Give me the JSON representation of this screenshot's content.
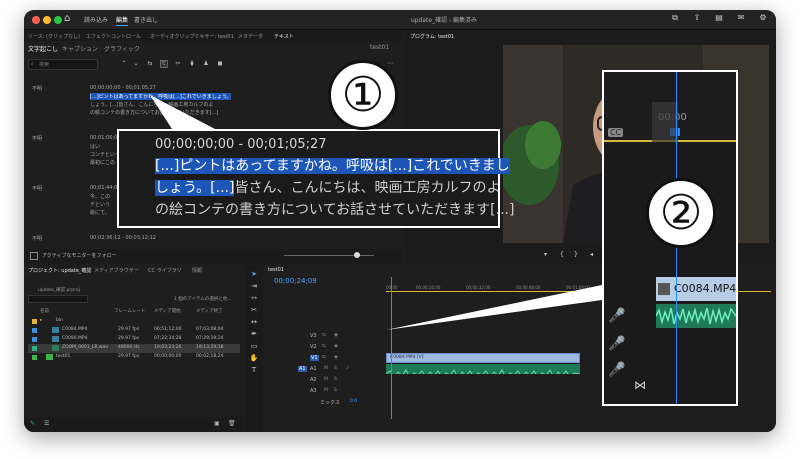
{
  "window": {
    "title": "update_確認 - 編集済み",
    "nav": [
      "読み込み",
      "編集",
      "書き出し"
    ],
    "active_nav": "編集"
  },
  "source_panel": {
    "tabs": [
      "ソース: (クリップなし)",
      "エフェクトコントロール",
      "オーディオクリップミキサー: test01",
      "メタデータ",
      "テキスト"
    ],
    "sequence_name": "test01",
    "subtabs": [
      "文字起こし",
      "キャプション",
      "グラフィック"
    ],
    "search_placeholder": "検索",
    "speakers": [
      "不明",
      "不明",
      "不明",
      "不明"
    ],
    "blocks": [
      {
        "timecode": "00;00;00;00 - 00;01;05;27",
        "lines": [
          "[...]ピントはあってますかね。呼吸は[...]これでいきましょう。",
          "しょう。[...]皆さん、こんにちは、映画工房カルフのよ",
          "の絵コンテの書き方についてお話させていただきます[...]"
        ]
      },
      {
        "timecode": "00;01;06;00 -",
        "lines": [
          "はい",
          "コンテという",
          "最初にこの"
        ]
      },
      {
        "timecode": "00;01;44;00 -",
        "lines": [
          "今、この",
          "テという",
          "絵にて、"
        ]
      },
      {
        "timecode": "00;02;36;12 - 00;03;12;12",
        "lines": []
      }
    ],
    "follow_monitor_label": "アクティブなモニターをフォロー"
  },
  "program_panel": {
    "title": "プログラム: test01",
    "timecode_right": "00;00;30;20",
    "timecode_left": "00;00;00;00"
  },
  "project_panel": {
    "tabs": [
      "プロジェクト: update_確認",
      "メディアブラウザー",
      "CC ライブラリ",
      "情報"
    ],
    "project_file": "update_確認.prproj",
    "search_hint": "1 個のアイテムの選択と他...",
    "columns": [
      "名前",
      "フレームレート",
      "メディア開始",
      "メディア終了"
    ],
    "rows": [
      {
        "name": "bin",
        "fps": "",
        "start": "",
        "end": "",
        "color": "#e4b13a"
      },
      {
        "name": "C0084.MP4",
        "fps": "29.97 fps",
        "start": "06;51;12;00",
        "end": "07;03;08;04",
        "color": "#3a8fe0"
      },
      {
        "name": "C0090.MP4",
        "fps": "29.97 fps",
        "start": "07;22;34;28",
        "end": "07;29;19;24",
        "color": "#3a8fe0"
      },
      {
        "name": "ZOOM_0001_LR.wav",
        "fps": "48000 Hz",
        "start": "19;03;23;26",
        "end": "19;13;29;18",
        "color": "#2fb38a"
      },
      {
        "name": "test01",
        "fps": "29.97 fps",
        "start": "00;00;00;00",
        "end": "00;02;18;24",
        "color": "#3db34a"
      }
    ]
  },
  "timeline": {
    "tab": "test01",
    "timecode": "00;00;24;09",
    "ruler": [
      "00;00",
      "00;00;16;00",
      "00;00;32;00",
      "00;00;48;00",
      "00;01;04;02",
      "00;01;20;02",
      "00;01;36;02"
    ],
    "video_tracks": [
      "V3",
      "V2",
      "V1"
    ],
    "audio_tracks": [
      "A1",
      "A2",
      "A3"
    ],
    "mix_label": "ミックス",
    "mix_value": "0.0",
    "video_clip_label": "C0084.MP4 [V]"
  },
  "callout1": {
    "badge": "①",
    "timecode": "00;00;00;00 - 00;01;05;27",
    "line1_pre": "[...]",
    "line1_main": "ピントはあってますかね。呼吸は",
    "line1_mid": "[...]",
    "line1_post": "これでいきまし",
    "line2_pre": "しょう。",
    "line2_mid": "[...]",
    "line2_post": "皆さん、こんにちは、映画工房カルフのよ",
    "line3": "の絵コンテの書き方についてお話させていただきます[...]"
  },
  "callout2": {
    "badge": "②",
    "cc_label": "CC",
    "clip_label": "C0084.MP4",
    "ruler_label": "00;00"
  },
  "colors": {
    "accent": "#4aa3ff",
    "highlight": "#1d56b7",
    "audio_clip": "#1f7a5a",
    "video_clip": "#9fb8e0"
  }
}
